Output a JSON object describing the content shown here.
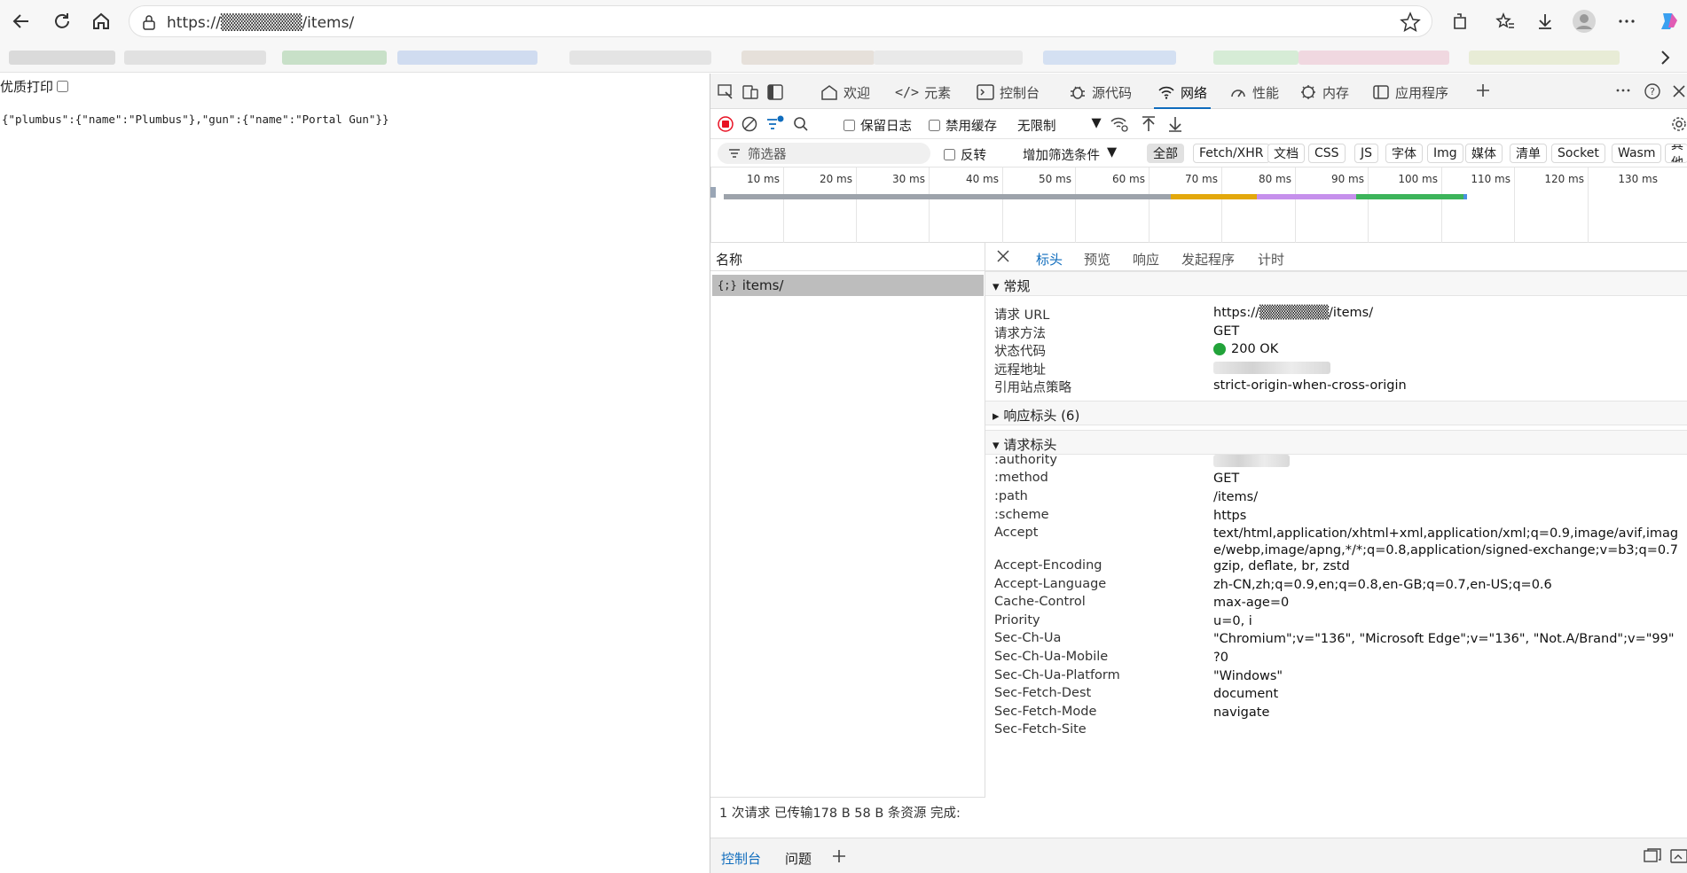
{
  "browser": {
    "url": "https://▒▒▒▒▒▒▒/items/",
    "icons": [
      "back-icon",
      "refresh-icon",
      "home-icon",
      "lock-icon",
      "star-icon",
      "extensions-icon",
      "favorites-icon",
      "download-icon",
      "profile-icon",
      "more-icon",
      "copilot-icon"
    ]
  },
  "page": {
    "print_label": "优质打印",
    "json_text": "{\"plumbus\":{\"name\":\"Plumbus\"},\"gun\":{\"name\":\"Portal Gun\"}}"
  },
  "devtools": {
    "tabs": [
      "欢迎",
      "元素",
      "控制台",
      "源代码",
      "网络",
      "性能",
      "内存",
      "应用程序"
    ],
    "active_tab": "网络",
    "toolbar": {
      "preserve_log": "保留日志",
      "disable_cache": "禁用缓存",
      "throttle": "无限制"
    },
    "filter": {
      "placeholder": "筛选器",
      "invert": "反转",
      "more_filters": "增加筛选条件",
      "chips": [
        "全部",
        "Fetch/XHR",
        "文档",
        "CSS",
        "JS",
        "字体",
        "Img",
        "媒体",
        "清单",
        "Socket",
        "Wasm",
        "其他"
      ]
    },
    "timeline": {
      "ticks": [
        "10 ms",
        "20 ms",
        "30 ms",
        "40 ms",
        "50 ms",
        "60 ms",
        "70 ms",
        "80 ms",
        "90 ms",
        "100 ms",
        "110 ms",
        "120 ms",
        "130 ms"
      ]
    },
    "requests": {
      "header": "名称",
      "items": [
        "items/"
      ]
    },
    "detail_tabs": [
      "标头",
      "预览",
      "响应",
      "发起程序",
      "计时"
    ],
    "general": {
      "title": "常规",
      "rows": [
        {
          "k": "请求 URL",
          "v": "https://▒▒▒▒▒▒▒/items/"
        },
        {
          "k": "请求方法",
          "v": "GET"
        },
        {
          "k": "状态代码",
          "v": "200 OK"
        },
        {
          "k": "远程地址",
          "v": ""
        },
        {
          "k": "引用站点策略",
          "v": "strict-origin-when-cross-origin"
        }
      ]
    },
    "response_headers": {
      "title": "响应标头 (6)"
    },
    "request_headers": {
      "title": "请求标头",
      "rows": [
        {
          "k": ":authority",
          "v": ""
        },
        {
          "k": ":method",
          "v": "GET"
        },
        {
          "k": ":path",
          "v": "/items/"
        },
        {
          "k": ":scheme",
          "v": "https"
        },
        {
          "k": "Accept",
          "v": "text/html,application/xhtml+xml,application/xml;q=0.9,image/avif,image/webp,image/apng,*/*;q=0.8,application/signed-exchange;v=b3;q=0.7"
        },
        {
          "k": "Accept-Encoding",
          "v": "gzip, deflate, br, zstd"
        },
        {
          "k": "Accept-Language",
          "v": "zh-CN,zh;q=0.9,en;q=0.8,en-GB;q=0.7,en-US;q=0.6"
        },
        {
          "k": "Cache-Control",
          "v": "max-age=0"
        },
        {
          "k": "Priority",
          "v": "u=0, i"
        },
        {
          "k": "Sec-Ch-Ua",
          "v": "\"Chromium\";v=\"136\", \"Microsoft Edge\";v=\"136\", \"Not.A/Brand\";v=\"99\""
        },
        {
          "k": "Sec-Ch-Ua-Mobile",
          "v": "?0"
        },
        {
          "k": "Sec-Ch-Ua-Platform",
          "v": "\"Windows\""
        },
        {
          "k": "Sec-Fetch-Dest",
          "v": "document"
        },
        {
          "k": "Sec-Fetch-Mode",
          "v": "navigate"
        },
        {
          "k": "Sec-Fetch-Site",
          "v": ""
        }
      ]
    },
    "status_bar": "1 次请求   已传输178 B   58 B 条资源   完成:",
    "drawer_tabs": [
      "控制台",
      "问题"
    ],
    "colors": {
      "accent": "#0f6cbd",
      "record": "#e81123",
      "status_ok": "#22a33a"
    }
  }
}
